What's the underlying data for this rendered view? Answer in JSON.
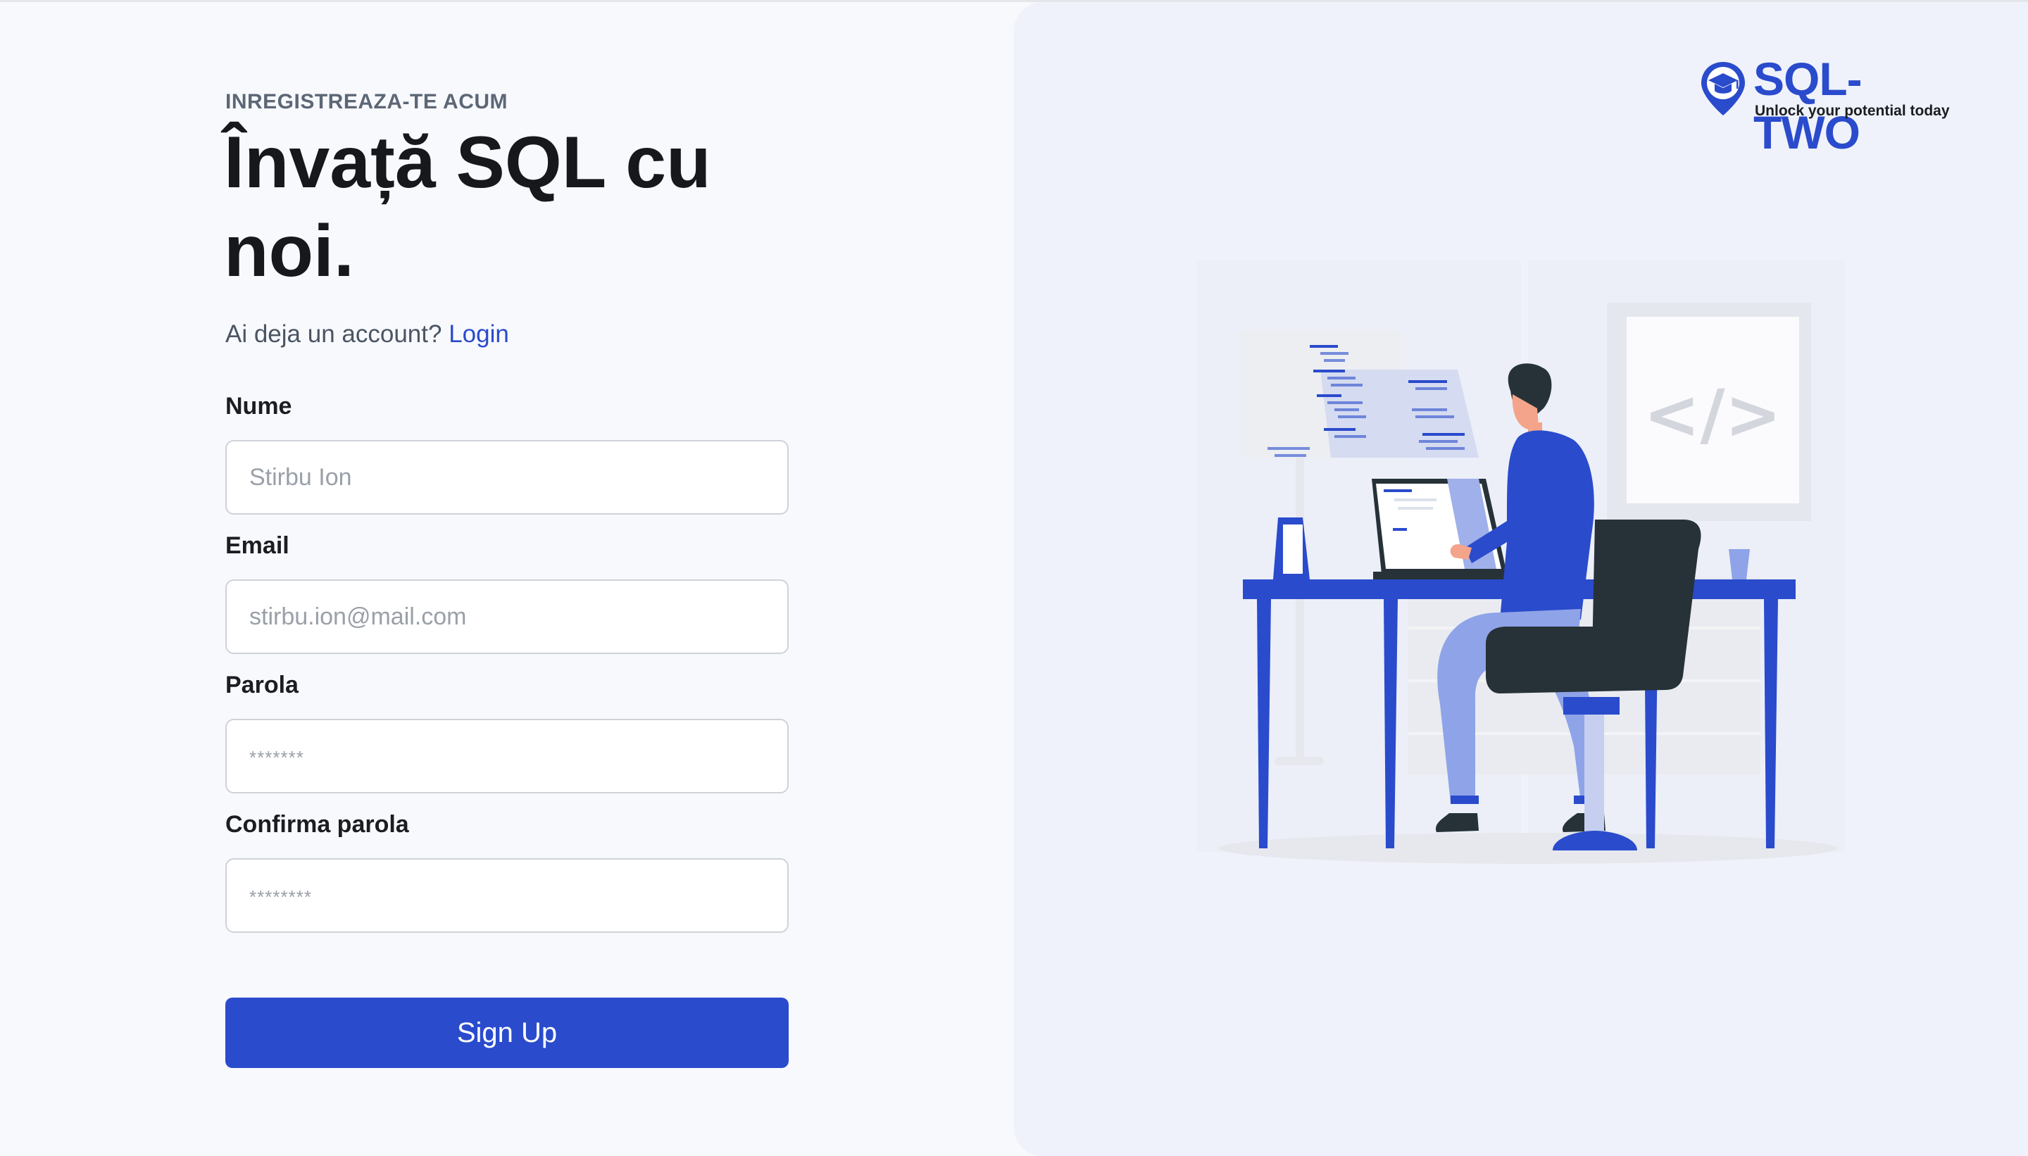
{
  "form": {
    "eyebrow": "INREGISTREAZA-TE ACUM",
    "headline": "Învață SQL cu noi.",
    "have_account_text": "Ai deja un account?",
    "login_link": "Login",
    "fields": [
      {
        "label": "Nume",
        "placeholder": "Stirbu Ion"
      },
      {
        "label": "Email",
        "placeholder": "stirbu.ion@mail.com"
      },
      {
        "label": "Parola",
        "placeholder": "*******"
      },
      {
        "label": "Confirma parola",
        "placeholder": "********"
      }
    ],
    "submit_label": "Sign Up"
  },
  "brand": {
    "name": "SQL-TWO",
    "tagline": "Unlock your potential today",
    "icon": "graduation-cap-pin-icon"
  },
  "illustration": {
    "code_tag": "</>",
    "description_icon": "developer-at-desk-illustration"
  },
  "colors": {
    "accent": "#2a4bcc",
    "page_bg": "#f8f9fd",
    "panel_bg": "#eff2fa",
    "input_border": "#cfd2d8"
  }
}
